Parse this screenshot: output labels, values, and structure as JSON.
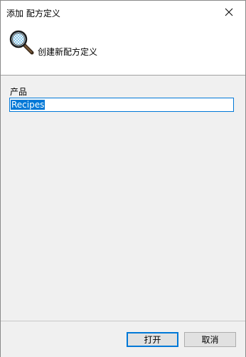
{
  "window": {
    "title": "添加 配方定义",
    "close_icon": "close-icon"
  },
  "header": {
    "icon": "magnifier-icon",
    "text": "创建新配方定义"
  },
  "form": {
    "product_label": "产品",
    "product_value": "Recipes"
  },
  "buttons": {
    "open_label": "打开",
    "cancel_label": "取消"
  },
  "colors": {
    "accent": "#0078d7",
    "panel_bg": "#f0f0f0",
    "button_bg": "#e1e1e1"
  }
}
